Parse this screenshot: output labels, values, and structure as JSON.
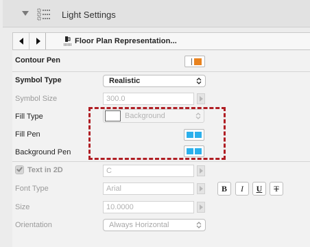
{
  "header": {
    "title": "Light Settings",
    "icon": "settings-list-icon"
  },
  "navbar": {
    "prev_icon": "arrow-left-icon",
    "next_icon": "arrow-right-icon",
    "representation_label": "Floor Plan Representation..."
  },
  "rows": {
    "contour_pen": {
      "label": "Contour Pen",
      "pen_color": "#e8821e"
    },
    "symbol_type": {
      "label": "Symbol Type",
      "value": "Realistic"
    },
    "symbol_size": {
      "label": "Symbol Size",
      "value": "300.0"
    },
    "fill_type": {
      "label": "Fill Type",
      "value": "Background"
    },
    "fill_pen": {
      "label": "Fill Pen",
      "pen_color": "#2bb0ec"
    },
    "background_pen": {
      "label": "Background Pen",
      "pen_color": "#2bb0ec"
    },
    "text_in_2d": {
      "label": "Text in 2D",
      "value": "C",
      "checked": true
    },
    "font_type": {
      "label": "Font Type",
      "value": "Arial"
    },
    "format_buttons": {
      "bold": "B",
      "italic": "I",
      "underline": "U",
      "strike": "T"
    },
    "size": {
      "label": "Size",
      "value": "10.0000"
    },
    "orientation": {
      "label": "Orientation",
      "value": "Always Horizontal"
    }
  },
  "annotation": {
    "color": "#b01e24",
    "style": "dashed"
  }
}
